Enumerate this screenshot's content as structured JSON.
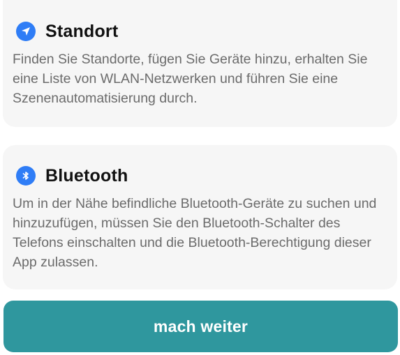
{
  "location_card": {
    "title": "Standort",
    "icon": "location-arrow-icon",
    "description": "Finden Sie Standorte, fügen Sie Geräte hinzu, erhalten Sie eine Liste von WLAN-Netzwerken und führen Sie eine Szenenautomatisierung durch."
  },
  "bluetooth_card": {
    "title": "Bluetooth",
    "icon": "bluetooth-icon",
    "description": "Um in der Nähe befindliche Bluetooth-Geräte zu suchen und hinzuzufügen, müssen Sie den Bluetooth-Schalter des Telefons einschalten und die Bluetooth-Berechtigung dieser App zulassen."
  },
  "continue_button": {
    "label": "mach weiter"
  },
  "colors": {
    "icon_blue": "#2f7df6",
    "button_teal": "#2f979e",
    "card_background": "#f6f6f6",
    "description_text": "#6b6b6b"
  }
}
